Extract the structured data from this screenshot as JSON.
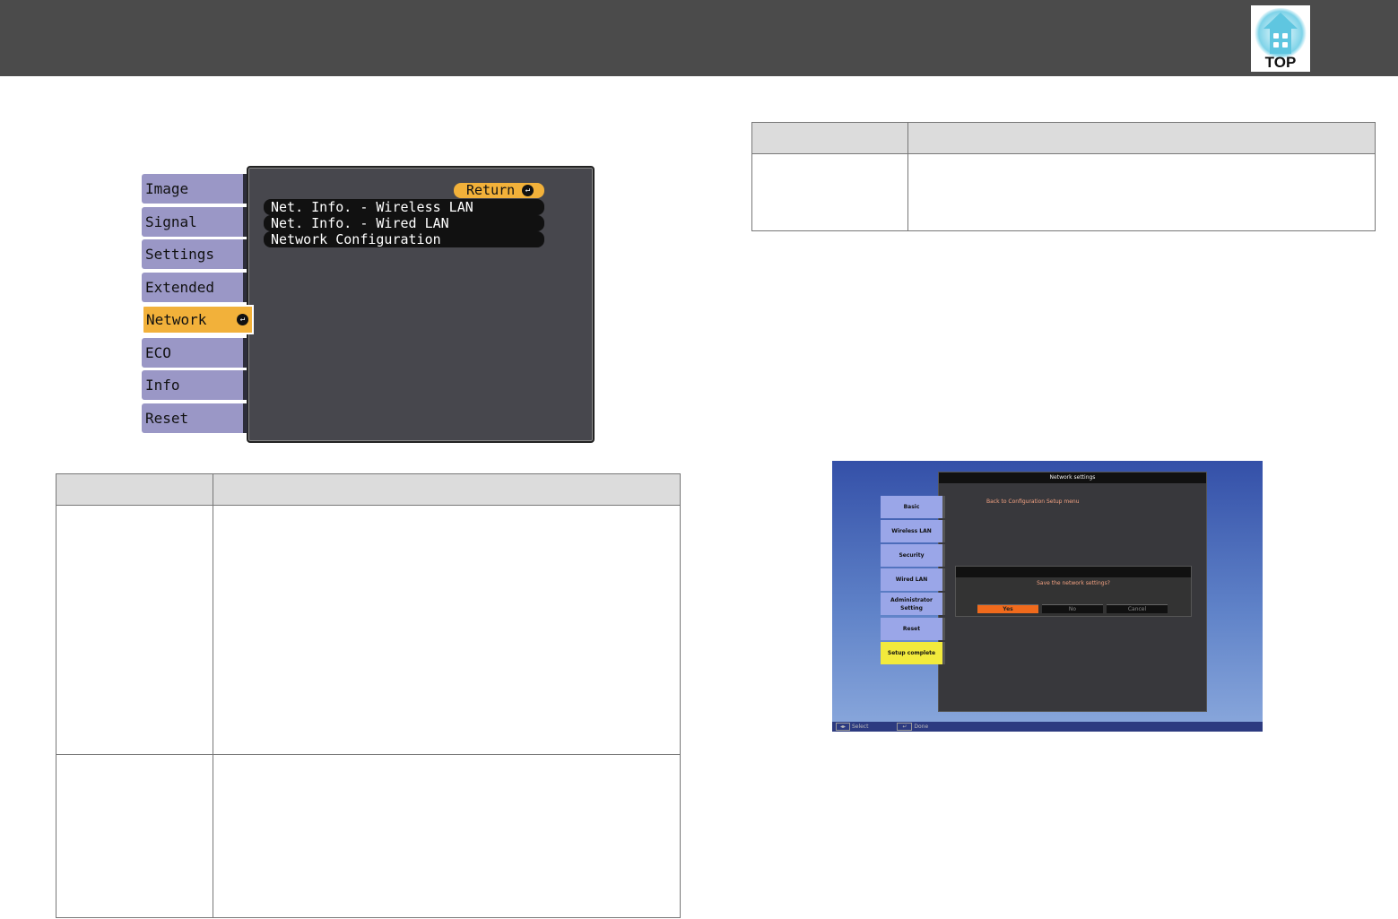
{
  "header": {
    "top_button": "TOP"
  },
  "projector_menu": {
    "tabs": [
      "Image",
      "Signal",
      "Settings",
      "Extended",
      "Network",
      "ECO",
      "Info",
      "Reset"
    ],
    "active_tab": "Network",
    "return_label": "Return",
    "items": [
      "Net. Info. - Wireless LAN",
      "Net. Info. - Wired LAN",
      "Network Configuration"
    ]
  },
  "network_settings": {
    "title": "Network settings",
    "back_link": "Back to Configuration Setup menu",
    "sidebar": [
      "Basic",
      "Wireless LAN",
      "Security",
      "Wired LAN",
      "Administrator Setting",
      "Reset",
      "Setup complete"
    ],
    "dialog_question": "Save the network settings?",
    "buttons": {
      "yes": "Yes",
      "no": "No",
      "cancel": "Cancel"
    },
    "footer": {
      "select": "Select",
      "done": "Done"
    }
  },
  "colors": {
    "accent": "#f2b13a",
    "tab": "#9a97c6",
    "yes": "#f06a1c"
  }
}
